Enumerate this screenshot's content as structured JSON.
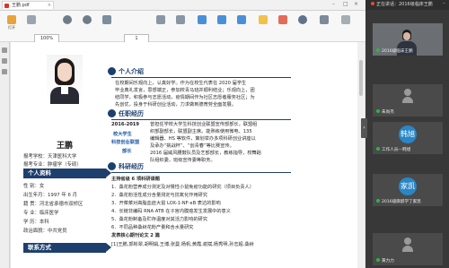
{
  "pdf": {
    "tab_title": "王鹏.pdf",
    "toolbar": {
      "buttons": [
        "打开",
        "",
        "",
        "",
        "",
        "",
        "",
        "",
        "",
        "",
        "",
        "",
        "",
        "",
        "",
        "",
        ""
      ],
      "zoom": "100%",
      "page": "1"
    },
    "resume": {
      "name": "王鹏",
      "apply_school_label": "报考学校：",
      "apply_school": "天津医科大学",
      "apply_major_label": "报考专业：",
      "apply_major": "肿瘤学（专硕）",
      "personal_title": "个人资料",
      "gender": "性    别：女",
      "birth": "出生年月：1997 年 6 月",
      "hometown": "籍    贯：河北省承德市双桥区",
      "major": "专    业：临床医学",
      "degree": "学    历：本科",
      "politics": "政治面貌：中共党员",
      "contact_title": "联系方式",
      "intro_title": "个人介绍",
      "intro_lines": [
        "在校期间乐观向上，认真好学。作为在校生代表在 2020 届学生",
        "毕业典礼发言，思想端正，参加校青马班并顺利结业；乐观向上，团",
        "结同学，积极参与志愿活动，疫情期间作为社区志愿者服务社区；为",
        "先创优，投身于科研创业活动，力求做到德育劳全面发展。"
      ],
      "work_title": "任职经历",
      "work_years": "2016-2019",
      "work_orgs": [
        "校大学生",
        "科技创业联盟"
      ],
      "work_role": "部长",
      "work_lines": [
        "曾担任学校大学生科技创业联盟宣传部部长，联盟组",
        "织部副部长，联盟副主席。能熟练使用微电、135",
        "编辑器、HS 等软件，策划举办多项科研创业讲座以",
        "及承办“挑战杯”、“创青春”等比赛宣传。",
        "2016 届威风腰鼓队员及艺部部长，教练指导，校舞蹈",
        "队组织委，班级宣传委等职务。"
      ],
      "research_title": "科研经历",
      "research_lines": [
        "主持省级 6 项科研课题",
        "1．桑花粉营养成分测定及对慢性小鼠免疫功能的研究（项目负责人）",
        "2．桑花粉活性成分含量测定与抗氧化作用研究",
        "3．开菜菜对高脂血症大鼠 LOX-1-NF-κB 表达的影响",
        "4．长链非编码 RNA ATB 在子宫内膜癌发生发展中的意义",
        "5．桑花粉制备及贮存温度对其活力影响的研究",
        "6．不同品种桑树花粉产量和含水量研究"
      ],
      "paper_heading": "发表核心期刊论文 2 篇",
      "paper_line": "[1]王鹏,郭彬翠,胡明娟,王博,张曼,杨帆,黄霞,谢斌,杨秀明,孙志超.桑树"
    }
  },
  "meeting": {
    "title": "正在讲话：2016级临床王鹏",
    "side_toggle": "›",
    "tiles": [
      {
        "caption": "2016级临床王鹏"
      },
      {
        "caption": "朱尚杰"
      },
      {
        "avatar": "韩旭",
        "caption": "工作人员—韩旭"
      },
      {
        "avatar": "家凯",
        "caption": "2016级麻醉学了家凯"
      },
      {
        "caption": "黄力力"
      }
    ],
    "colors": {
      "avatar1": "#2a86c6",
      "avatar2": "#2a86c6"
    }
  }
}
